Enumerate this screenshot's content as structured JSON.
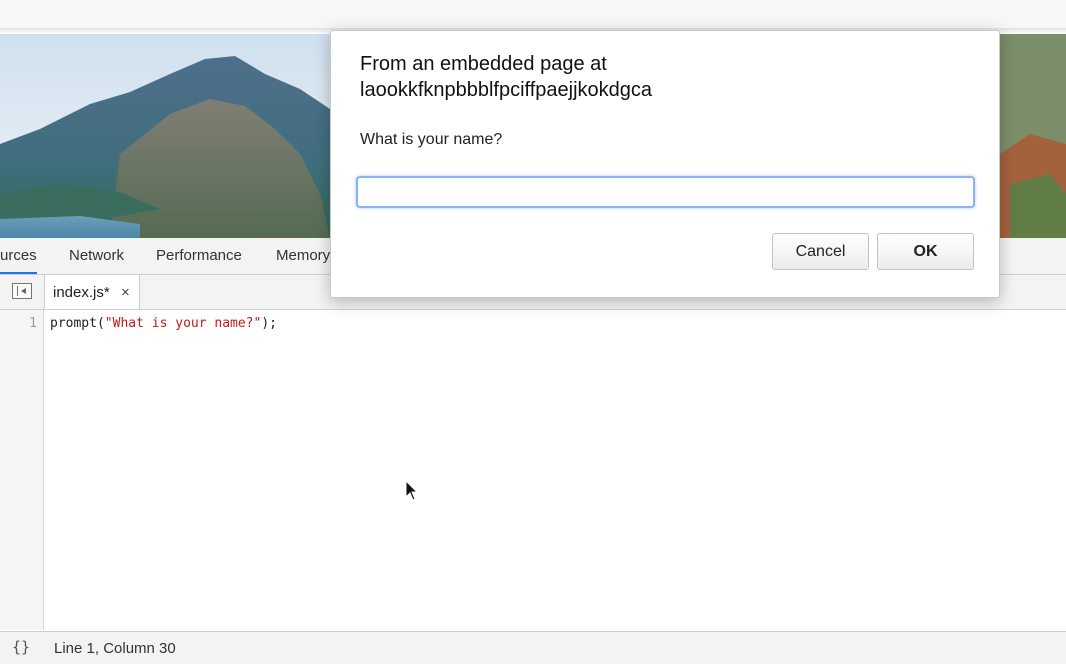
{
  "devtools": {
    "tabs": [
      {
        "label": "urces",
        "active": true
      },
      {
        "label": "Network"
      },
      {
        "label": "Performance"
      },
      {
        "label": "Memory"
      }
    ]
  },
  "editor": {
    "file_tab": {
      "name": "index.js*",
      "close": "×"
    },
    "lines": [
      {
        "number": "1",
        "code_prefix": "prompt(",
        "code_string": "\"What is your name?\"",
        "code_suffix": ");"
      }
    ]
  },
  "status_bar": {
    "format_icon": "{}",
    "cursor_position": "Line 1, Column 30"
  },
  "dialog": {
    "title_line1": "From an embedded page at",
    "title_line2": "laookkfknpbbblfpciffpaejjkokdgca",
    "message": "What is your name?",
    "input_value": "",
    "cancel_label": "Cancel",
    "ok_label": "OK"
  },
  "colors": {
    "accent": "#1a73e8",
    "string": "#c41a16",
    "input_focus": "#8ab4f0"
  }
}
